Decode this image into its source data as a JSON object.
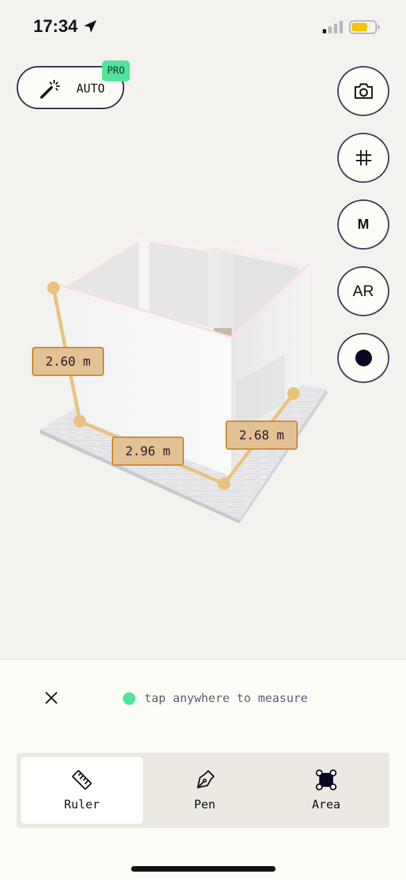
{
  "status_bar": {
    "time": "17:34"
  },
  "auto_button": {
    "label": "AUTO",
    "badge": "PRO"
  },
  "side_buttons": {
    "m_label": "M",
    "ar_label": "AR"
  },
  "measurements": [
    {
      "label": "2.60 m"
    },
    {
      "label": "2.96 m"
    },
    {
      "label": "2.68 m"
    }
  ],
  "hint": {
    "text": "tap anywhere to measure"
  },
  "tabs": [
    {
      "label": "Ruler",
      "icon": "ruler-icon",
      "active": true
    },
    {
      "label": "Pen",
      "icon": "pen-icon",
      "active": false
    },
    {
      "label": "Area",
      "icon": "area-icon",
      "active": false
    }
  ],
  "colors": {
    "accent_green": "#52e49a",
    "measure_line": "#e8c27e",
    "tag_fill": "#e4c193",
    "tag_border": "#c98a32",
    "button_border": "#2a2744"
  }
}
